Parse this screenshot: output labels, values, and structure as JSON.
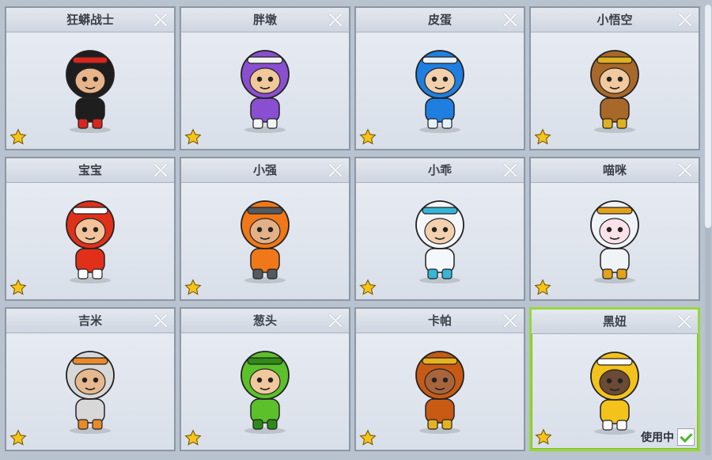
{
  "characters": [
    {
      "name": "狂蟒战士",
      "icon": "warrior-character-icon",
      "main": "#1e1e1e",
      "accent": "#d8261e",
      "skin": "#e8b48a"
    },
    {
      "name": "胖墩",
      "icon": "purple-bunny-character-icon",
      "main": "#8a4fd0",
      "accent": "#f4f4f4",
      "skin": "#f0c89a"
    },
    {
      "name": "皮蛋",
      "icon": "blue-hood-character-icon",
      "main": "#1f7fe0",
      "accent": "#e8f2ff",
      "skin": "#f2d0ac"
    },
    {
      "name": "小悟空",
      "icon": "monkey-king-character-icon",
      "main": "#a8682a",
      "accent": "#e0b020",
      "skin": "#f1c99e"
    },
    {
      "name": "宝宝",
      "icon": "red-baby-character-icon",
      "main": "#e0301a",
      "accent": "#ffffff",
      "skin": "#f2c39a"
    },
    {
      "name": "小强",
      "icon": "helmet-character-icon",
      "main": "#f07818",
      "accent": "#555a60",
      "skin": "#e3b187"
    },
    {
      "name": "小乖",
      "icon": "white-bear-character-icon",
      "main": "#f4f7fb",
      "accent": "#36b6d8",
      "skin": "#f4d0ae"
    },
    {
      "name": "喵咪",
      "icon": "lucky-cat-character-icon",
      "main": "#f0f3f8",
      "accent": "#e4a21a",
      "skin": "#f9e3e8"
    },
    {
      "name": "吉米",
      "icon": "skull-helmet-character-icon",
      "main": "#d8d8d8",
      "accent": "#e98a2a",
      "skin": "#e6b88d"
    },
    {
      "name": "葱头",
      "icon": "green-hair-character-icon",
      "main": "#5cc02a",
      "accent": "#2f8a18",
      "skin": "#f0c89c"
    },
    {
      "name": "卡帕",
      "icon": "tribal-mask-character-icon",
      "main": "#c85a14",
      "accent": "#e6b21e",
      "skin": "#a8653c"
    },
    {
      "name": "黑妞",
      "icon": "yellow-cat-character-icon",
      "main": "#f3c21b",
      "accent": "#ffffff",
      "skin": "#6b4a36"
    }
  ],
  "selected_index": 11,
  "in_use_label": "使用中",
  "star_color": "#f5c418",
  "selected_border_color": "#98d63a"
}
